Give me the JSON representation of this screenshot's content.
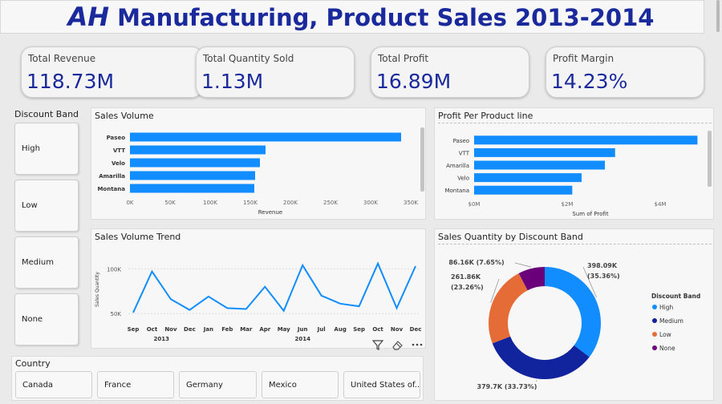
{
  "header": {
    "title_prefix": "AH",
    "title_rest": " Manufacturing, Product Sales 2013-2014"
  },
  "kpis": [
    {
      "label": "Total Revenue",
      "value": "118.73M"
    },
    {
      "label": "Total Quantity Sold",
      "value": "1.13M"
    },
    {
      "label": "Total Profit",
      "value": "16.89M"
    },
    {
      "label": "Profit Margin",
      "value": "14.23%"
    }
  ],
  "discount_slicer": {
    "title": "Discount Band",
    "options": [
      "High",
      "Low",
      "Medium",
      "None"
    ]
  },
  "country_slicer": {
    "title": "Country",
    "options": [
      "Canada",
      "France",
      "Germany",
      "Mexico",
      "United States of..."
    ]
  },
  "colors": {
    "bar": "#118dff",
    "high": "#118dff",
    "medium": "#12239e",
    "low": "#e66c37",
    "none": "#6b007b",
    "title": "#1a2a9c"
  },
  "icons": [
    "filter-icon",
    "eraser-icon",
    "more-options-icon"
  ],
  "chart_data": [
    {
      "id": "sales_volume",
      "type": "bar",
      "title": "Sales Volume",
      "xlabel": "Revenue",
      "categories": [
        "Paseo",
        "VTT",
        "Velo",
        "Amarilla",
        "Montana"
      ],
      "values": [
        338000,
        169000,
        162000,
        156000,
        155000
      ],
      "xlim": [
        0,
        350000
      ],
      "ticks": [
        0,
        50000,
        100000,
        150000,
        200000,
        250000,
        300000,
        350000
      ],
      "tick_labels": [
        "0K",
        "50K",
        "100K",
        "150K",
        "200K",
        "250K",
        "300K",
        "350K"
      ]
    },
    {
      "id": "profit_per_product_line",
      "type": "bar",
      "title": "Profit Per Product line",
      "xlabel": "Sum of Profit",
      "categories": [
        "Paseo",
        "VTT",
        "Amarilla",
        "Velo",
        "Montana"
      ],
      "values": [
        4800000,
        3030000,
        2810000,
        2310000,
        2110000
      ],
      "xlim": [
        0,
        5000000
      ],
      "ticks": [
        0,
        2000000,
        4000000
      ],
      "tick_labels": [
        "$0M",
        "$2M",
        "$4M"
      ]
    },
    {
      "id": "sales_volume_trend",
      "type": "line",
      "title": "Sales Volume Trend",
      "ylabel": "Sales Quantity",
      "x": [
        "Sep",
        "Oct",
        "Nov",
        "Dec",
        "Jan",
        "Feb",
        "Mar",
        "Apr",
        "May",
        "Jun",
        "Jul",
        "Aug",
        "Sep",
        "Oct",
        "Nov",
        "Dec"
      ],
      "year_labels": [
        {
          "label": "2013",
          "index": 1.5
        },
        {
          "label": "2014",
          "index": 9
        }
      ],
      "values": [
        51000,
        97000,
        66000,
        54000,
        69000,
        56000,
        55000,
        80000,
        53000,
        104000,
        70000,
        61000,
        58000,
        106000,
        56000,
        103000
      ],
      "ylim": [
        42000,
        112000
      ],
      "yticks": [
        50000,
        100000
      ],
      "ytick_labels": [
        "50K",
        "100K"
      ]
    },
    {
      "id": "sales_quantity_by_discount_band",
      "type": "pie",
      "title": "Sales Quantity by Discount Band",
      "legend_title": "Discount Band",
      "legend_position": "right",
      "slices": [
        {
          "name": "High",
          "value": 398090,
          "label": "398.09K",
          "pct": "(35.36%)"
        },
        {
          "name": "Medium",
          "value": 379700,
          "label": "379.7K (33.73%)",
          "pct": ""
        },
        {
          "name": "Low",
          "value": 261860,
          "label": "261.86K",
          "pct": "(23.26%)"
        },
        {
          "name": "None",
          "value": 86160,
          "label": "86.16K (7.65%)",
          "pct": ""
        }
      ]
    }
  ]
}
